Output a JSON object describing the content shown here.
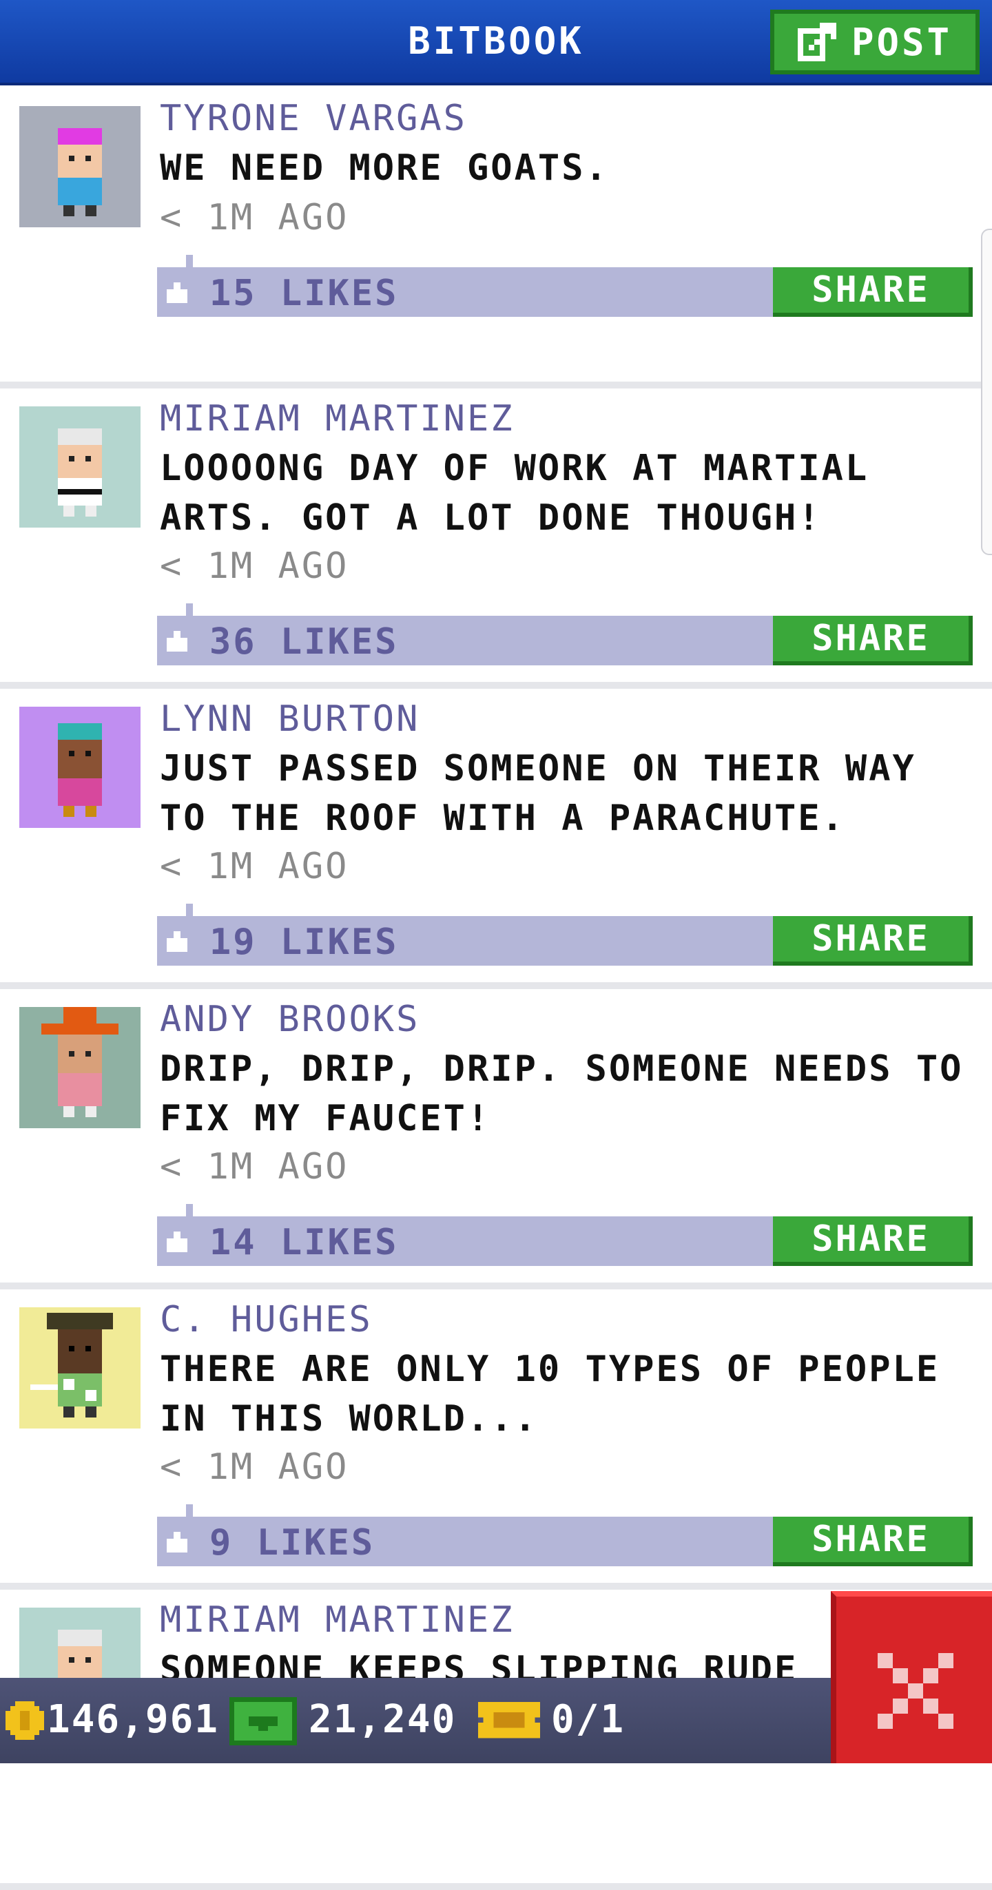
{
  "header": {
    "title": "BITBOOK",
    "post_label": "POST"
  },
  "posts": [
    {
      "author": "TYRONE VARGAS",
      "message": "WE NEED MORE GOATS.",
      "time": "< 1M AGO",
      "likes": "15 LIKES",
      "share_label": "SHARE",
      "avatar_bg": "#a8adba",
      "hair": "#e13be3",
      "shirt": "#39a6dd",
      "skin": "#f3c8a6"
    },
    {
      "author": "MIRIAM MARTINEZ",
      "message": "LOOOONG DAY OF WORK AT MARTIAL ARTS. GOT A LOT DONE THOUGH!",
      "time": "< 1M AGO",
      "likes": "36 LIKES",
      "share_label": "SHARE",
      "avatar_bg": "#b4d6cf",
      "hair": "#e8e8e8",
      "shirt": "#ffffff",
      "skin": "#f3c8a6"
    },
    {
      "author": "LYNN BURTON",
      "message": "JUST PASSED SOMEONE ON THEIR WAY TO THE ROOF WITH A PARACHUTE.",
      "time": "< 1M AGO",
      "likes": "19 LIKES",
      "share_label": "SHARE",
      "avatar_bg": "#c08ef1",
      "hair": "#2fb3b0",
      "shirt": "#d7489d",
      "skin": "#8a5234"
    },
    {
      "author": "ANDY BROOKS",
      "message": "DRIP, DRIP, DRIP. SOMEONE NEEDS TO FIX MY FAUCET!",
      "time": "< 1M AGO",
      "likes": "14 LIKES",
      "share_label": "SHARE",
      "avatar_bg": "#8fb1a3",
      "hair": "#e25a12",
      "shirt": "#e88fa0",
      "skin": "#d8a07a"
    },
    {
      "author": "C. HUGHES",
      "message": "THERE ARE ONLY 10 TYPES OF PEOPLE IN THIS WORLD...",
      "time": "< 1M AGO",
      "likes": "9 LIKES",
      "share_label": "SHARE",
      "avatar_bg": "#f1eb97",
      "hair": "#3f3a22",
      "shirt": "#7bbf68",
      "skin": "#5a3a24"
    },
    {
      "author": "MIRIAM MARTINEZ",
      "message": "SOMEONE KEEPS SLIPPING RUDE",
      "time": "",
      "likes": "",
      "share_label": "",
      "avatar_bg": "#b4d6cf",
      "hair": "#e8e8e8",
      "shirt": "#ffffff",
      "skin": "#f3c8a6"
    }
  ],
  "bottom_bar": {
    "coins": "146,961",
    "bux": "21,240",
    "tickets": "0/1"
  },
  "colors": {
    "accent_green": "#3aa83a",
    "header_blue": "#1f57c6",
    "like_bar": "#b4b6d8",
    "close_red": "#d82428"
  }
}
